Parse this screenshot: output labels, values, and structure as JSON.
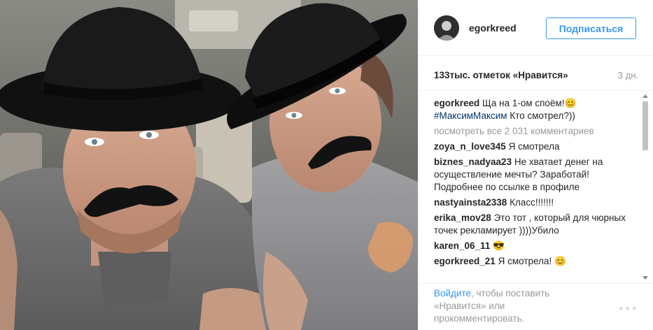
{
  "header": {
    "username": "egorkreed",
    "follow_label": "Подписаться",
    "avatar_icon": "profile-avatar"
  },
  "stats": {
    "likes": "133тыс. отметок «Нравится»",
    "time_ago": "3 дн."
  },
  "caption": {
    "user": "egorkreed",
    "text_before": "Ща на 1-ом споём!😊",
    "hashtag": "#МаксимМаксим",
    "text_after": " Кто смотрел?))"
  },
  "view_all_comments": "посмотреть все 2 031 комментариев",
  "comments": [
    {
      "user": "zoya_n_love345",
      "text": "Я смотрела"
    },
    {
      "user": "biznes_nadyaa23",
      "text": "Не хватает дeнeг на осуществление мечты? Заработай! Подробнее по ссылке в профиле"
    },
    {
      "user": "nastyainsta2338",
      "text": "Класс!!!!!!!"
    },
    {
      "user": "erika_mov28",
      "text": "Это тот , который для чюрных точек рекламирует ))))Убило"
    },
    {
      "user": "karen_06_11",
      "text": "😎"
    },
    {
      "user": "egorkreed_21",
      "text": "Я смотрела! 😊"
    }
  ],
  "footer": {
    "login_link": "Войдите",
    "text": ", чтобы поставить «Нравится» или прокомментировать.",
    "more_icon": "ellipsis-icon",
    "more_glyph": "∘∘∘"
  },
  "colors": {
    "link_blue": "#3897f0",
    "hashtag_blue": "#003569",
    "muted_gray": "#999999",
    "text": "#262626"
  }
}
